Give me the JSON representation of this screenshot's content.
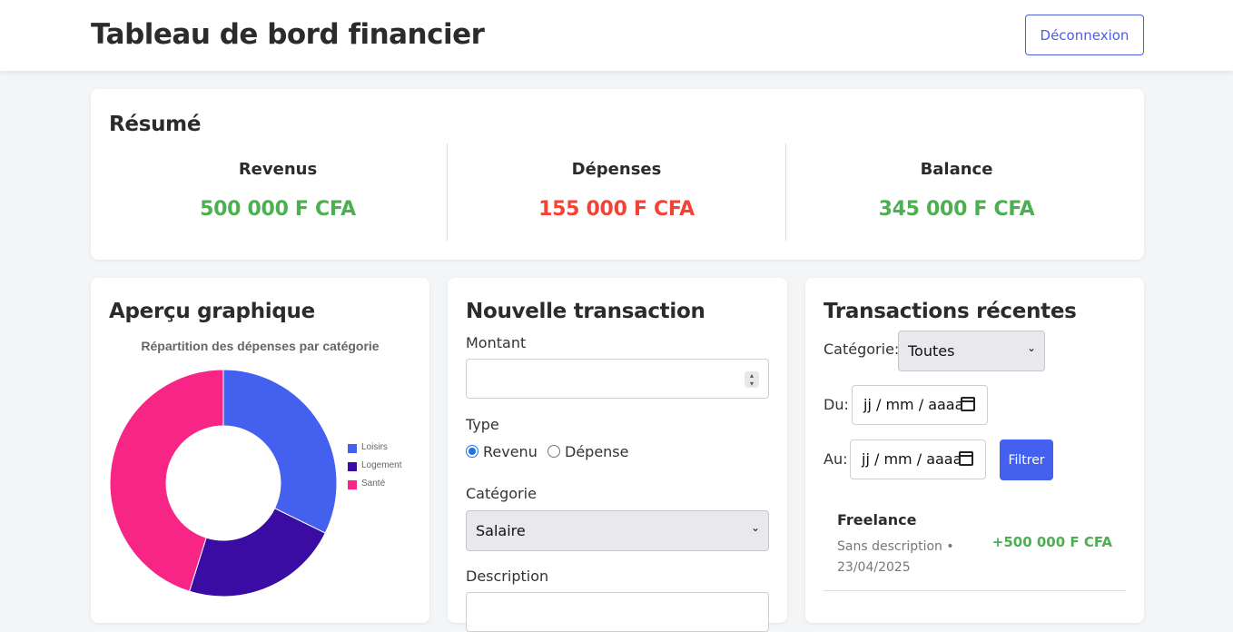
{
  "header": {
    "title": "Tableau de bord financier",
    "logout_label": "Déconnexion"
  },
  "summary": {
    "title": "Résumé",
    "items": [
      {
        "label": "Revenus",
        "value": "500 000 F CFA",
        "color": "#4caf50"
      },
      {
        "label": "Dépenses",
        "value": "155 000 F CFA",
        "color": "#f44336"
      },
      {
        "label": "Balance",
        "value": "345 000 F CFA",
        "color": "#4caf50"
      }
    ]
  },
  "chart_card": {
    "title": "Aperçu graphique"
  },
  "chart_data": {
    "type": "pie",
    "donut": true,
    "title": "Répartition des dépenses par catégorie",
    "legend_position": "right",
    "slices": [
      {
        "label": "Loisirs",
        "value": 50000,
        "color": "#4361ee"
      },
      {
        "label": "Logement",
        "value": 35000,
        "color": "#3a0ca3"
      },
      {
        "label": "Santé",
        "value": 70000,
        "color": "#f72585"
      }
    ]
  },
  "form": {
    "title": "Nouvelle transaction",
    "amount_label": "Montant",
    "amount_value": "",
    "type_label": "Type",
    "type_options": [
      {
        "label": "Revenu",
        "checked": true
      },
      {
        "label": "Dépense",
        "checked": false
      }
    ],
    "category_label": "Catégorie",
    "category_value": "Salaire",
    "description_label": "Description"
  },
  "transactions": {
    "title": "Transactions récentes",
    "filter_category_label": "Catégorie:",
    "filter_category_value": "Toutes",
    "from_label": "Du:",
    "to_label": "Au:",
    "date_placeholder": "jj / mm / aaaa",
    "filter_button": "Filtrer",
    "items": [
      {
        "name": "Freelance",
        "description": "Sans description • 23/04/2025",
        "amount": "+500 000 F CFA",
        "color": "#4caf50"
      }
    ]
  }
}
